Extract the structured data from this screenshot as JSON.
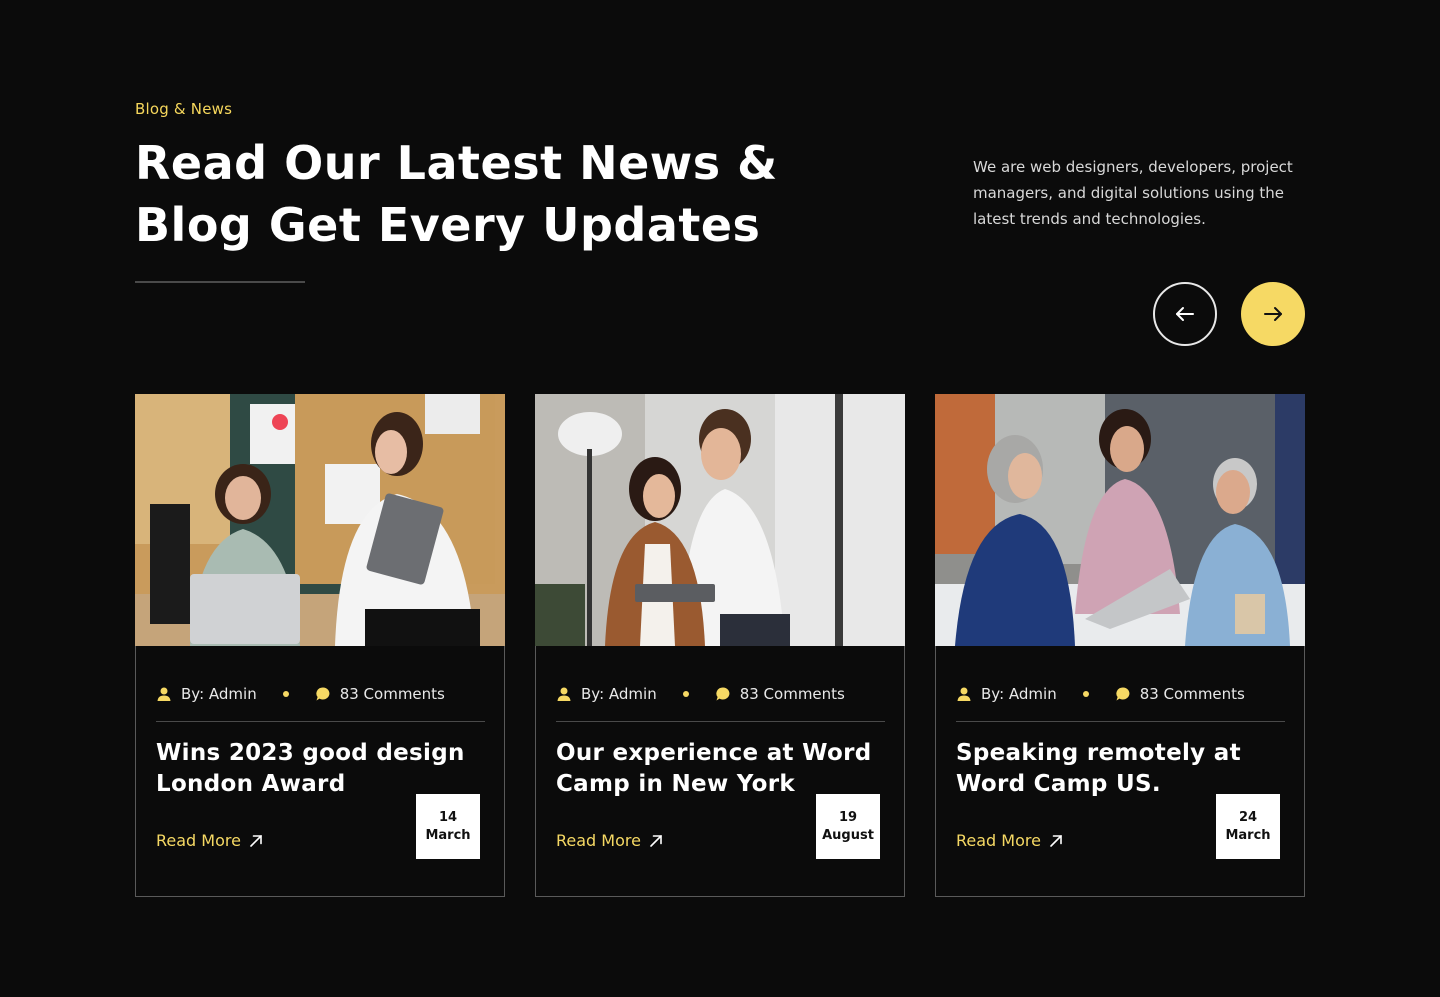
{
  "header": {
    "eyebrow": "Blog & News",
    "headline_line1": "Read Our Latest News &",
    "headline_line2": "Blog Get Every Updates",
    "intro": "We are web designers, developers, project managers, and digital solutions using the latest trends and technologies."
  },
  "nav": {
    "prev_icon": "arrow-left-icon",
    "next_icon": "arrow-right-icon"
  },
  "colors": {
    "background": "#0b0b0b",
    "accent": "#f6d964",
    "text": "#ffffff"
  },
  "posts": [
    {
      "author": "By: Admin",
      "comments": "83 Comments",
      "title": "Wins 2023 good design London Award",
      "read_more": "Read More",
      "day": "14",
      "month": "March"
    },
    {
      "author": "By: Admin",
      "comments": "83 Comments",
      "title": "Our experience at Word Camp in New York",
      "read_more": "Read More",
      "day": "19",
      "month": "August"
    },
    {
      "author": "By: Admin",
      "comments": "83 Comments",
      "title": "Speaking remotely at Word Camp US.",
      "read_more": "Read More",
      "day": "24",
      "month": "March"
    }
  ]
}
